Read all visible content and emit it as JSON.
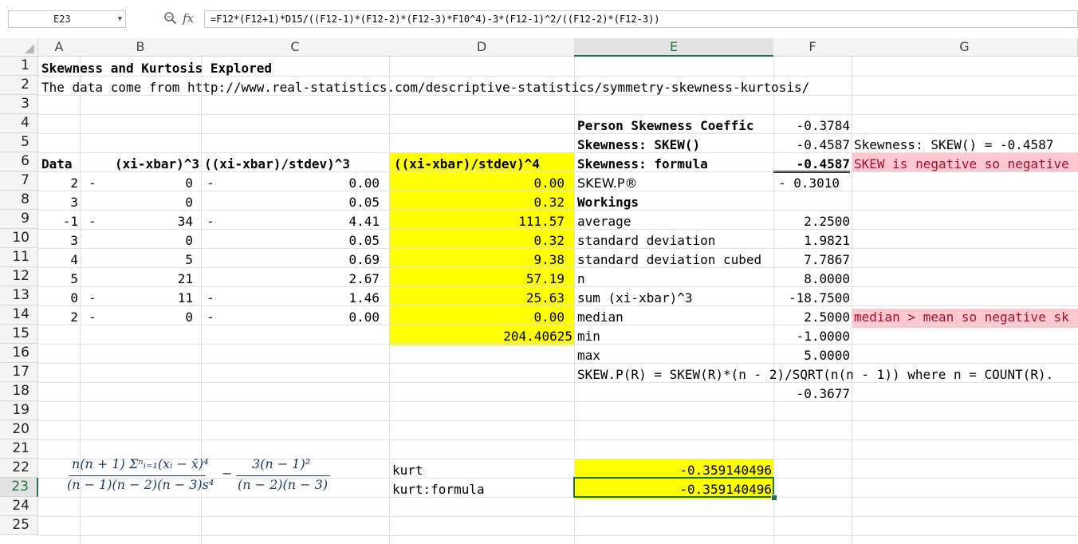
{
  "name_box": "E23",
  "fx_label": "fx",
  "formula_bar": "=F12*(F12+1)*D15/((F12-1)*(F12-2)*(F12-3)*F10^4)-3*(F12-1)^2/((F12-2)*(F12-3))",
  "columns": [
    "A",
    "B",
    "C",
    "D",
    "E",
    "F",
    "G"
  ],
  "rows": [
    "1",
    "2",
    "3",
    "4",
    "5",
    "6",
    "7",
    "8",
    "9",
    "10",
    "11",
    "12",
    "13",
    "14",
    "15",
    "16",
    "17",
    "18",
    "19",
    "20",
    "21",
    "22",
    "23",
    "24",
    "25"
  ],
  "selected_cell": "E23",
  "colors": {
    "yellow_fill": "#ffff00",
    "pink_fill": "#ffc7ce",
    "pink_text": "#9c0006",
    "selection": "#217346"
  },
  "cells": {
    "A1": "Skewness and Kurtosis Explored",
    "A2": "The data come from http://www.real-statistics.com/descriptive-statistics/symmetry-skewness-kurtosis/",
    "E4": "Person Skewness Coeffic",
    "F4": "-0.3784",
    "E5": "Skewness: SKEW()",
    "F5": "-0.4587",
    "G5": "Skewness: SKEW() = -0.4587",
    "A6": "Data",
    "B6": "(xi-xbar)^3",
    "C6": "((xi-xbar)/stdev)^3",
    "D6": "((xi-xbar)/stdev)^4",
    "E6": "Skewness: formula",
    "F6": "-0.4587",
    "G6": "SKEW is negative so negative",
    "A7": "2",
    "B7a": "-",
    "B7": "0",
    "C7a": "-",
    "C7": "0.00",
    "D7": "0.00",
    "E7": "SKEW.P®",
    "F7": "- 0.3010",
    "A8": "3",
    "B8": "0",
    "C8": "0.05",
    "D8": "0.32",
    "E8": "Workings",
    "A9": "-1",
    "B9a": "-",
    "B9": "34",
    "C9a": "-",
    "C9": "4.41",
    "D9": "111.57",
    "E9": "average",
    "F9": "2.2500",
    "A10": "3",
    "B10": "0",
    "C10": "0.05",
    "D10": "0.32",
    "E10": "standard deviation",
    "F10": "1.9821",
    "A11": "4",
    "B11": "5",
    "C11": "0.69",
    "D11": "9.38",
    "E11": "standard deviation cubed",
    "F11": "7.7867",
    "A12": "5",
    "B12": "21",
    "C12": "2.67",
    "D12": "57.19",
    "E12": "n",
    "F12": "8.0000",
    "A13": "0",
    "B13a": "-",
    "B13": "11",
    "C13a": "-",
    "C13": "1.46",
    "D13": "25.63",
    "E13": "sum (xi-xbar)^3",
    "F13": "-18.7500",
    "A14": "2",
    "B14a": "-",
    "B14": "0",
    "C14a": "-",
    "C14": "0.00",
    "D14": "0.00",
    "E14": "median",
    "F14": "2.5000",
    "G14": "median > mean so negative sk",
    "D15": "204.40625",
    "E15": "min",
    "F15": "-1.0000",
    "E16": "max",
    "F16": "5.0000",
    "E17": "SKEW.P(R) = SKEW(R)*(n - 2)/SQRT(n(n - 1)) where n = COUNT(R).",
    "F18": "-0.3677",
    "D22": "kurt",
    "E22": "-0.359140496",
    "D23": "kurt:formula",
    "E23": "-0.359140496"
  },
  "kurtosis_formula": {
    "term1_numerator": "n(n + 1) Σⁿᵢ₌₁(xᵢ − x̄)⁴",
    "term1_denominator": "(n − 1)(n − 2)(n − 3)s⁴",
    "minus": "−",
    "term2_numerator": "3(n − 1)²",
    "term2_denominator": "(n − 2)(n − 3)"
  }
}
